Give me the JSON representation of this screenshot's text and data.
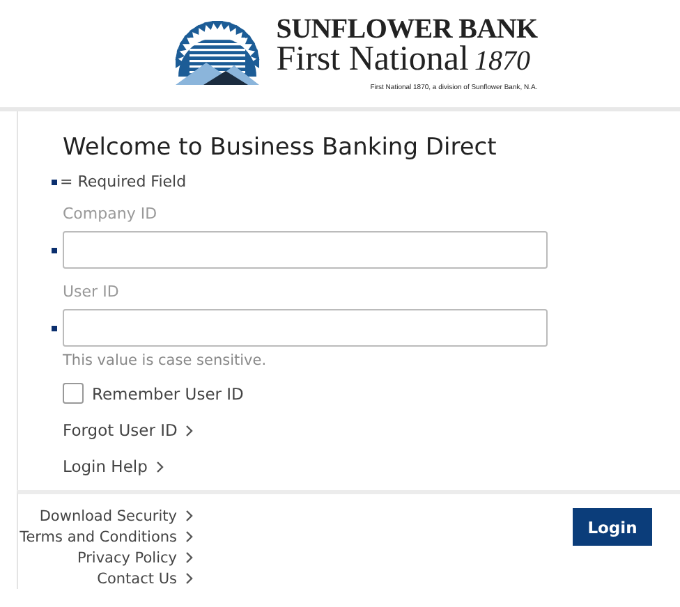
{
  "header": {
    "brand_line_1": "SUNFLOWER BANK",
    "brand_line_2": "First National",
    "brand_year": "1870",
    "tagline": "First National 1870, a division of Sunflower Bank, N.A."
  },
  "title": "Welcome to Business Banking Direct",
  "required_legend": "= Required Field",
  "fields": [
    {
      "label": "Company ID",
      "required": true
    },
    {
      "label": "User ID",
      "required": true,
      "hint": "This value is case sensitive."
    }
  ],
  "remember": {
    "label": "Remember User ID",
    "checked": false
  },
  "links": [
    "Forgot User ID",
    "Login Help"
  ],
  "footer_links": [
    "Download Security",
    "Terms and Conditions",
    "Privacy Policy",
    "Contact Us"
  ],
  "login_button": "Login"
}
